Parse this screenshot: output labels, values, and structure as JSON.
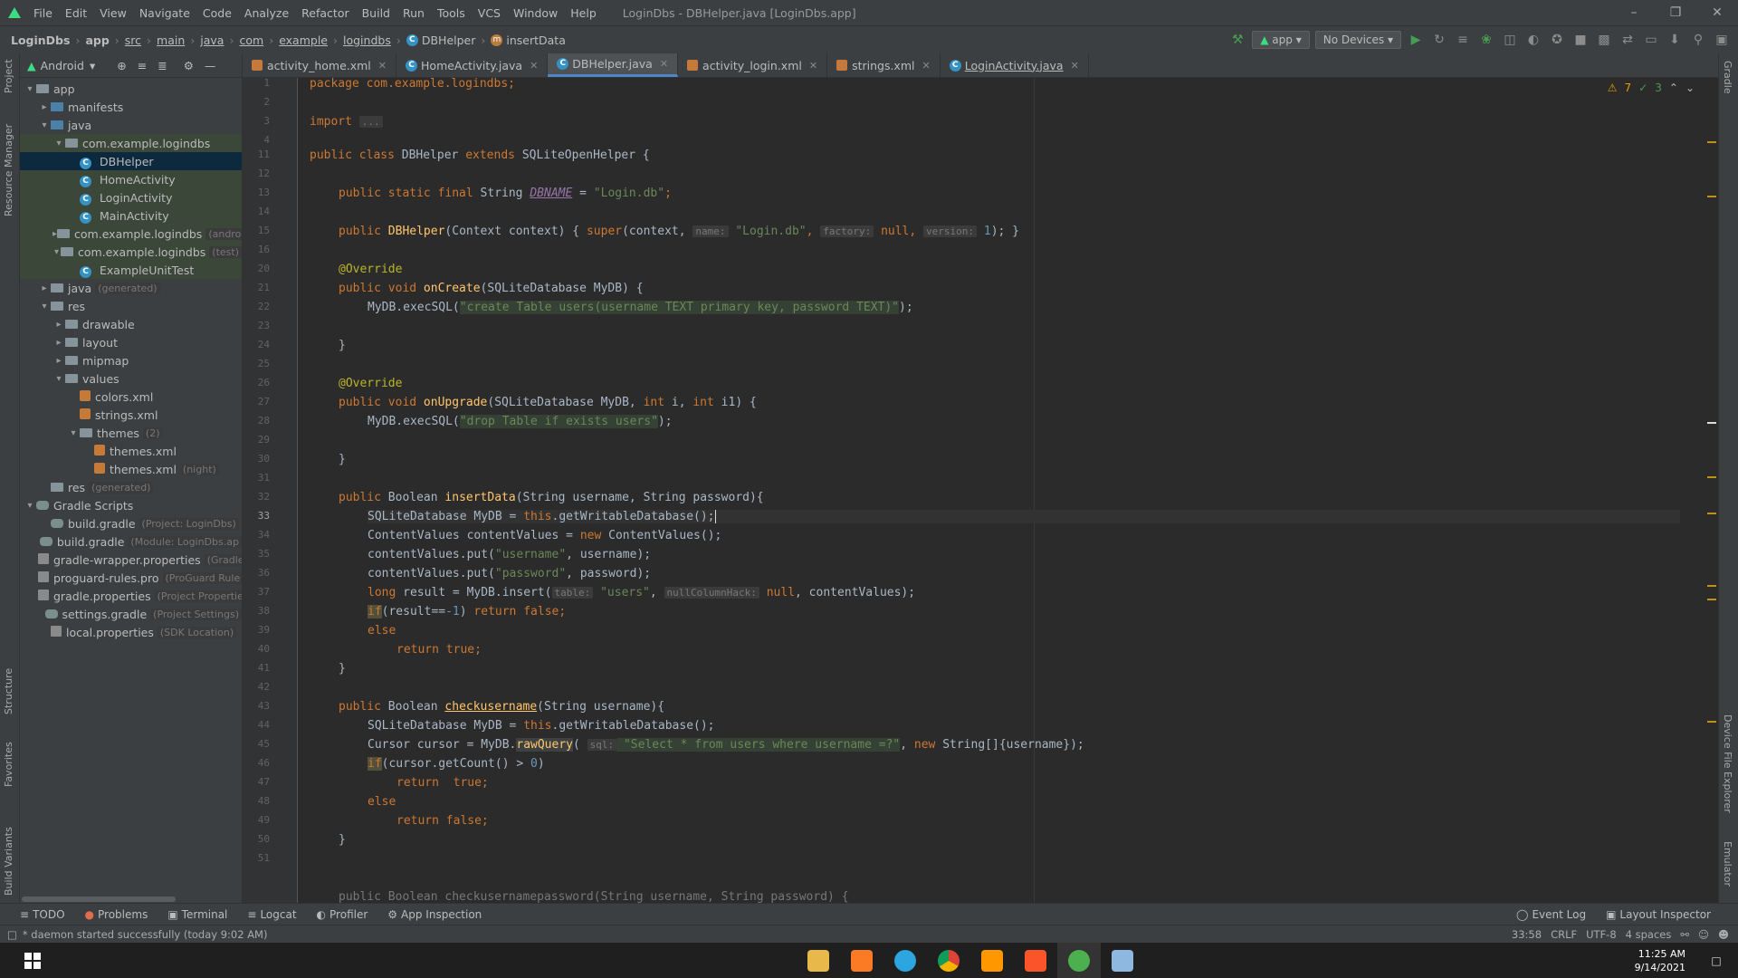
{
  "menubar": {
    "items": [
      "File",
      "Edit",
      "View",
      "Navigate",
      "Code",
      "Analyze",
      "Refactor",
      "Build",
      "Run",
      "Tools",
      "VCS",
      "Window",
      "Help"
    ],
    "title": "LoginDbs - DBHelper.java [LoginDbs.app]"
  },
  "breadcrumb": [
    "LoginDbs",
    "app",
    "src",
    "main",
    "java",
    "com",
    "example",
    "logindbs",
    "DBHelper",
    "insertData"
  ],
  "toolbar": {
    "module": "app",
    "device": "No Devices"
  },
  "project": {
    "view": "Android",
    "tree": [
      {
        "label": "app",
        "depth": 0,
        "arrow": "▾",
        "icon": "folder",
        "name": "tree-app"
      },
      {
        "label": "manifests",
        "depth": 1,
        "arrow": "▸",
        "icon": "folder-blue",
        "name": "tree-manifests"
      },
      {
        "label": "java",
        "depth": 1,
        "arrow": "▾",
        "icon": "folder-blue",
        "name": "tree-java"
      },
      {
        "label": "com.example.logindbs",
        "depth": 2,
        "arrow": "▾",
        "icon": "folder",
        "name": "tree-package",
        "tint": true
      },
      {
        "label": "DBHelper",
        "depth": 3,
        "arrow": "",
        "icon": "class",
        "name": "tree-dbhelper",
        "sel": true
      },
      {
        "label": "HomeActivity",
        "depth": 3,
        "arrow": "",
        "icon": "class",
        "name": "tree-homeactivity",
        "tint": true
      },
      {
        "label": "LoginActivity",
        "depth": 3,
        "arrow": "",
        "icon": "class",
        "name": "tree-loginactivity",
        "tint": true
      },
      {
        "label": "MainActivity",
        "depth": 3,
        "arrow": "",
        "icon": "class",
        "name": "tree-mainactivity",
        "tint": true
      },
      {
        "label": "com.example.logindbs",
        "hint": "(androi",
        "depth": 2,
        "arrow": "▸",
        "icon": "folder",
        "name": "tree-package-android",
        "tint": true
      },
      {
        "label": "com.example.logindbs",
        "hint": "(test)",
        "depth": 2,
        "arrow": "▾",
        "icon": "folder",
        "name": "tree-package-test",
        "tint": true
      },
      {
        "label": "ExampleUnitTest",
        "depth": 3,
        "arrow": "",
        "icon": "class",
        "name": "tree-exampleunittest",
        "tint": true
      },
      {
        "label": "java",
        "hint": "(generated)",
        "depth": 1,
        "arrow": "▸",
        "icon": "folder",
        "name": "tree-java-generated"
      },
      {
        "label": "res",
        "depth": 1,
        "arrow": "▾",
        "icon": "folder",
        "name": "tree-res"
      },
      {
        "label": "drawable",
        "depth": 2,
        "arrow": "▸",
        "icon": "folder",
        "name": "tree-drawable"
      },
      {
        "label": "layout",
        "depth": 2,
        "arrow": "▸",
        "icon": "folder",
        "name": "tree-layout"
      },
      {
        "label": "mipmap",
        "depth": 2,
        "arrow": "▸",
        "icon": "folder",
        "name": "tree-mipmap"
      },
      {
        "label": "values",
        "depth": 2,
        "arrow": "▾",
        "icon": "folder",
        "name": "tree-values"
      },
      {
        "label": "colors.xml",
        "depth": 3,
        "arrow": "",
        "icon": "xml",
        "name": "tree-colors-xml"
      },
      {
        "label": "strings.xml",
        "depth": 3,
        "arrow": "",
        "icon": "xml",
        "name": "tree-strings-xml"
      },
      {
        "label": "themes",
        "hint": "(2)",
        "depth": 3,
        "arrow": "▾",
        "icon": "folder",
        "name": "tree-themes"
      },
      {
        "label": "themes.xml",
        "depth": 4,
        "arrow": "",
        "icon": "xml",
        "name": "tree-themes-xml"
      },
      {
        "label": "themes.xml",
        "hint": "(night)",
        "depth": 4,
        "arrow": "",
        "icon": "xml",
        "name": "tree-themes-xml-night"
      },
      {
        "label": "res",
        "hint": "(generated)",
        "depth": 1,
        "arrow": "",
        "icon": "folder",
        "name": "tree-res-generated"
      },
      {
        "label": "Gradle Scripts",
        "depth": 0,
        "arrow": "▾",
        "icon": "gradle",
        "name": "tree-gradle-scripts"
      },
      {
        "label": "build.gradle",
        "hint": "(Project: LoginDbs)",
        "depth": 1,
        "arrow": "",
        "icon": "gradle",
        "name": "tree-build-gradle-project"
      },
      {
        "label": "build.gradle",
        "hint": "(Module: LoginDbs.ap",
        "depth": 1,
        "arrow": "",
        "icon": "gradle",
        "name": "tree-build-gradle-module"
      },
      {
        "label": "gradle-wrapper.properties",
        "hint": "(Gradle V",
        "depth": 1,
        "arrow": "",
        "icon": "prop",
        "name": "tree-gradle-wrapper"
      },
      {
        "label": "proguard-rules.pro",
        "hint": "(ProGuard Rule",
        "depth": 1,
        "arrow": "",
        "icon": "prop",
        "name": "tree-proguard"
      },
      {
        "label": "gradle.properties",
        "hint": "(Project Propertie",
        "depth": 1,
        "arrow": "",
        "icon": "prop",
        "name": "tree-gradle-properties"
      },
      {
        "label": "settings.gradle",
        "hint": "(Project Settings)",
        "depth": 1,
        "arrow": "",
        "icon": "gradle",
        "name": "tree-settings-gradle"
      },
      {
        "label": "local.properties",
        "hint": "(SDK Location)",
        "depth": 1,
        "arrow": "",
        "icon": "prop",
        "name": "tree-local-properties"
      }
    ]
  },
  "tabs": [
    {
      "label": "activity_home.xml",
      "icon": "xml"
    },
    {
      "label": "HomeActivity.java",
      "icon": "class"
    },
    {
      "label": "DBHelper.java",
      "icon": "class",
      "active": true
    },
    {
      "label": "activity_login.xml",
      "icon": "xml"
    },
    {
      "label": "strings.xml",
      "icon": "xml"
    },
    {
      "label": "LoginActivity.java",
      "icon": "class",
      "underline": true
    }
  ],
  "inspection": {
    "warnings": "7",
    "weak": "3"
  },
  "line_numbers": [
    "1",
    "2",
    "3",
    "4",
    "11",
    "12",
    "13",
    "14",
    "15",
    "16",
    "20",
    "21",
    "22",
    "23",
    "24",
    "25",
    "26",
    "27",
    "28",
    "29",
    "30",
    "31",
    "32",
    "33",
    "34",
    "35",
    "36",
    "37",
    "38",
    "39",
    "40",
    "41",
    "42",
    "43",
    "44",
    "45",
    "46",
    "47",
    "48",
    "49",
    "50",
    "51"
  ],
  "code": {
    "l1": "package com.example.logindbs;",
    "l4_kw": "import",
    "l4_fold": "...",
    "l12_a": "public class ",
    "l12_b": "DBHelper ",
    "l12_c": "extends ",
    "l12_d": "SQLiteOpenHelper {",
    "l14_a": "public static final ",
    "l14_b": "String ",
    "l14_c": "DBNAME",
    "l14_d": " = ",
    "l14_e": "\"Login.db\"",
    "l14_f": ";",
    "l16_a": "public ",
    "l16_b": "DBHelper",
    "l16_c": "(Context context) { ",
    "l16_d": "super",
    "l16_e": "(context, ",
    "l16_h1": "name:",
    "l16_f": " \"Login.db\"",
    "l16_g": ", ",
    "l16_h2": "factory:",
    "l16_i": " null",
    "l16_j": ", ",
    "l16_h3": "version:",
    "l16_k": " 1",
    "l16_l": "); }",
    "l20": "@Override",
    "l21_a": "public void ",
    "l21_b": "onCreate",
    "l21_c": "(SQLiteDatabase MyDB) {",
    "l22_a": "MyDB.execSQL(",
    "l22_b": "\"create Table users(username TEXT primary key, password TEXT)\"",
    "l22_c": ");",
    "l24": "}",
    "l26": "@Override",
    "l27_a": "public void ",
    "l27_b": "onUpgrade",
    "l27_c": "(SQLiteDatabase MyDB, ",
    "l27_d": "int ",
    "l27_e": "i, ",
    "l27_f": "int ",
    "l27_g": "i1) {",
    "l28_a": "MyDB.execSQL(",
    "l28_b": "\"drop Table if exists users\"",
    "l28_c": ");",
    "l30": "}",
    "l32_a": "public ",
    "l32_b": "Boolean ",
    "l32_c": "insertData",
    "l32_d": "(String username, String password){",
    "l33_a": "SQLiteDatabase MyDB = ",
    "l33_b": "this",
    "l33_c": ".getWritableDatabase();",
    "l34_a": "ContentValues contentValues = ",
    "l34_b": "new ",
    "l34_c": "ContentValues();",
    "l35_a": "contentValues.put(",
    "l35_b": "\"username\"",
    "l35_c": ", username);",
    "l36_a": "contentValues.put(",
    "l36_b": "\"password\"",
    "l36_c": ", password);",
    "l37_a": "long ",
    "l37_b": "result = MyDB.insert(",
    "l37_h1": "table:",
    "l37_c": " \"users\"",
    "l37_d": ", ",
    "l37_h2": "nullColumnHack:",
    "l37_e": " null",
    "l37_f": ", contentValues);",
    "l38_a": "if",
    "l38_b": "(result==",
    "l38_c": "-1",
    "l38_d": ") ",
    "l38_e": "return false",
    "l38_f": ";",
    "l39": "else",
    "l40_a": "return true",
    "l40_b": ";",
    "l41": "}",
    "l43_a": "public ",
    "l43_b": "Boolean ",
    "l43_c": "checkusername",
    "l43_d": "(String username){",
    "l44_a": "SQLiteDatabase MyDB = ",
    "l44_b": "this",
    "l44_c": ".getWritableDatabase();",
    "l45_a": "Cursor cursor = MyDB.",
    "l45_b": "rawQuery",
    "l45_c": "( ",
    "l45_h1": "sql:",
    "l45_d": " \"Select * from users where username =?\"",
    "l45_e": ", ",
    "l45_f": "new ",
    "l45_g": "String[]{username});",
    "l46_a": "if",
    "l46_b": "(cursor.getCount() > ",
    "l46_c": "0",
    "l46_d": ")",
    "l47_a": "return  true",
    "l47_b": ";",
    "l48": "else",
    "l49_a": "return false",
    "l49_b": ";",
    "l50": "}",
    "l52": "public Boolean checkusernamepassword(String username, String password) {"
  },
  "bottom_tools": [
    "TODO",
    "Problems",
    "Terminal",
    "Logcat",
    "Profiler",
    "App Inspection"
  ],
  "bottom_right_tools": [
    "Event Log",
    "Layout Inspector"
  ],
  "status": {
    "message": "* daemon started successfully (today 9:02 AM)",
    "position": "33:58",
    "line_sep": "CRLF",
    "encoding": "UTF-8",
    "indent": "4 spaces"
  },
  "side_labels": {
    "left": [
      "Project",
      "Resource Manager",
      "Structure",
      "Favorites",
      "Build Variants"
    ],
    "right": [
      "Gradle",
      "Device File Explorer",
      "Emulator"
    ]
  },
  "taskbar": {
    "time": "11:25 AM",
    "date": "9/14/2021"
  }
}
